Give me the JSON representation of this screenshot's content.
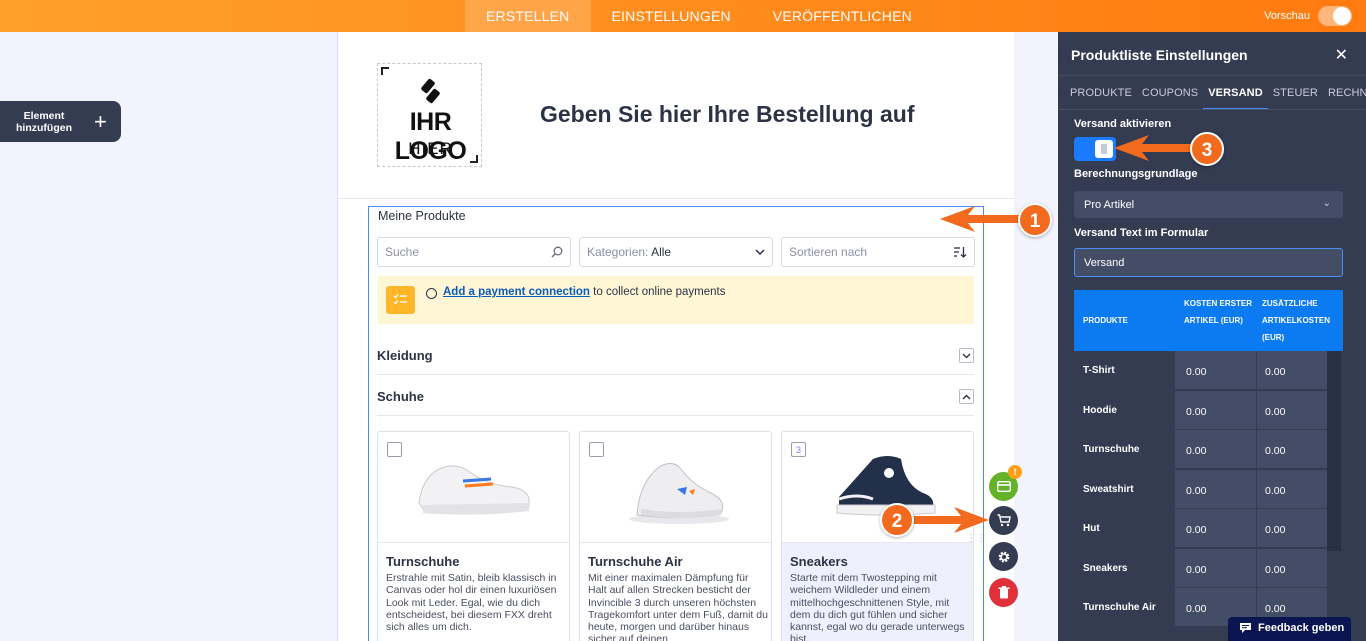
{
  "topnav": {
    "tabs": [
      "ERSTELLEN",
      "EINSTELLUNGEN",
      "VERÖFFENTLICHEN"
    ],
    "preview_label": "Vorschau"
  },
  "left": {
    "add_element_label": "Element hinzufügen"
  },
  "header": {
    "logo_line1": "IHR LOGO",
    "logo_line2": "HIER",
    "title": "Geben Sie hier Ihre Bestellung auf"
  },
  "widget": {
    "label": "Meine Produkte",
    "search_placeholder": "Suche",
    "category_label": "Kategorien:",
    "category_value": "Alle",
    "sort_placeholder": "Sortieren nach",
    "payment_link": "Add a payment connection",
    "payment_text": " to collect online payments",
    "categories": [
      "Kleidung",
      "Schuhe"
    ],
    "products": [
      {
        "name": "Turnschuhe",
        "desc": "Erstrahle mit Satin, bleib klassisch in Canvas oder hol dir einen luxuriösen Look mit Leder. Egal, wie du dich entscheidest, bei diesem FXX dreht sich alles um dich.",
        "check": ""
      },
      {
        "name": "Turnschuhe Air",
        "desc": "Mit einer maximalen Dämpfung für Halt auf allen Strecken besticht der Invincible 3 durch unseren höchsten Tragekomfort unter dem Fuß, damit du heute, morgen und darüber hinaus sicher auf deinen",
        "check": ""
      },
      {
        "name": "Sneakers",
        "desc": "Starte mit dem Twostepping mit weichem Wildleder und einem mittelhochgeschnittenen Style, mit dem du dich gut fühlen und sicher kannst, egal wo du gerade unterwegs bist.",
        "check": "3"
      }
    ]
  },
  "side": {
    "badge": "!"
  },
  "annotations": [
    "1",
    "2",
    "3"
  ],
  "panel": {
    "title": "Produktliste Einstellungen",
    "tabs": [
      "PRODUKTE",
      "COUPONS",
      "VERSAND",
      "STEUER",
      "RECHNUNG"
    ],
    "enable_label": "Versand aktivieren",
    "basis_label": "Berechnungsgrundlage",
    "basis_value": "Pro Artikel",
    "text_label": "Versand Text im Formular",
    "text_value": "Versand",
    "table": {
      "headers": [
        "PRODUKTE",
        "KOSTEN ERSTER ARTIKEL (EUR)",
        "ZUSÄTZLICHE ARTIKELKOSTEN (EUR)"
      ],
      "rows": [
        {
          "name": "T-Shirt",
          "first": "0.00",
          "extra": "0.00"
        },
        {
          "name": "Hoodie",
          "first": "0.00",
          "extra": "0.00"
        },
        {
          "name": "Turnschuhe",
          "first": "0.00",
          "extra": "0.00"
        },
        {
          "name": "Sweatshirt",
          "first": "0.00",
          "extra": "0.00"
        },
        {
          "name": "Hut",
          "first": "0.00",
          "extra": "0.00"
        },
        {
          "name": "Sneakers",
          "first": "0.00",
          "extra": "0.00"
        },
        {
          "name": "Turnschuhe Air",
          "first": "0.00",
          "extra": "0.00"
        }
      ]
    }
  },
  "feedback_label": "Feedback geben",
  "colors": {
    "accent_orange": "#ff7a0f",
    "panel_bg": "#343c52",
    "primary_blue": "#0c7bf1"
  }
}
